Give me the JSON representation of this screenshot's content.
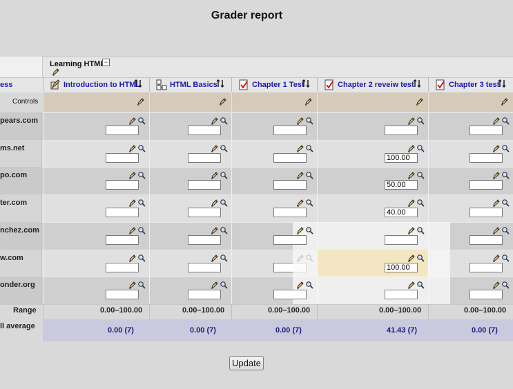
{
  "page": {
    "title": "Grader report"
  },
  "category": {
    "name": "Learning HTML",
    "collapse_symbol": "−"
  },
  "header": {
    "user_col_label": "ess"
  },
  "columns": [
    {
      "label": "Introduction to HTML",
      "icon": "assignment-icon"
    },
    {
      "label": "HTML Basics",
      "icon": "lesson-icon"
    },
    {
      "label": "Chapter 1 Test",
      "icon": "quiz-icon"
    },
    {
      "label": "Chapter 2 reveiw test",
      "icon": "quiz-icon"
    },
    {
      "label": "Chapter 3 test",
      "icon": "quiz-icon"
    }
  ],
  "controls_label": "Controls",
  "students": [
    {
      "name": "pears.com",
      "grades": [
        "",
        "",
        "",
        "",
        ""
      ]
    },
    {
      "name": "ms.net",
      "grades": [
        "",
        "",
        "",
        "100.00",
        ""
      ]
    },
    {
      "name": "po.com",
      "grades": [
        "",
        "",
        "",
        "50.00",
        ""
      ]
    },
    {
      "name": "ter.com",
      "grades": [
        "",
        "",
        "",
        "40.00",
        ""
      ]
    },
    {
      "name": "nchez.com",
      "grades": [
        "",
        "",
        "",
        "",
        ""
      ]
    },
    {
      "name": "w.com",
      "grades": [
        "",
        "",
        "",
        "100.00",
        ""
      ]
    },
    {
      "name": "onder.org",
      "grades": [
        "",
        "",
        "",
        "",
        ""
      ]
    }
  ],
  "range": {
    "label": "Range",
    "values": [
      "0.00–100.00",
      "0.00–100.00",
      "0.00–100.00",
      "0.00–100.00",
      "0.00–100.00"
    ]
  },
  "average": {
    "label": "ll average",
    "values": [
      "0.00 (7)",
      "0.00 (7)",
      "0.00 (7)",
      "41.43 (7)",
      "0.00 (7)"
    ]
  },
  "actions": {
    "update_label": "Update"
  },
  "colors": {
    "controls_bg": "#d4cbbb",
    "avg_bg": "#cacade",
    "highlight": "#f3e6c2",
    "link": "#1a1ab5"
  }
}
